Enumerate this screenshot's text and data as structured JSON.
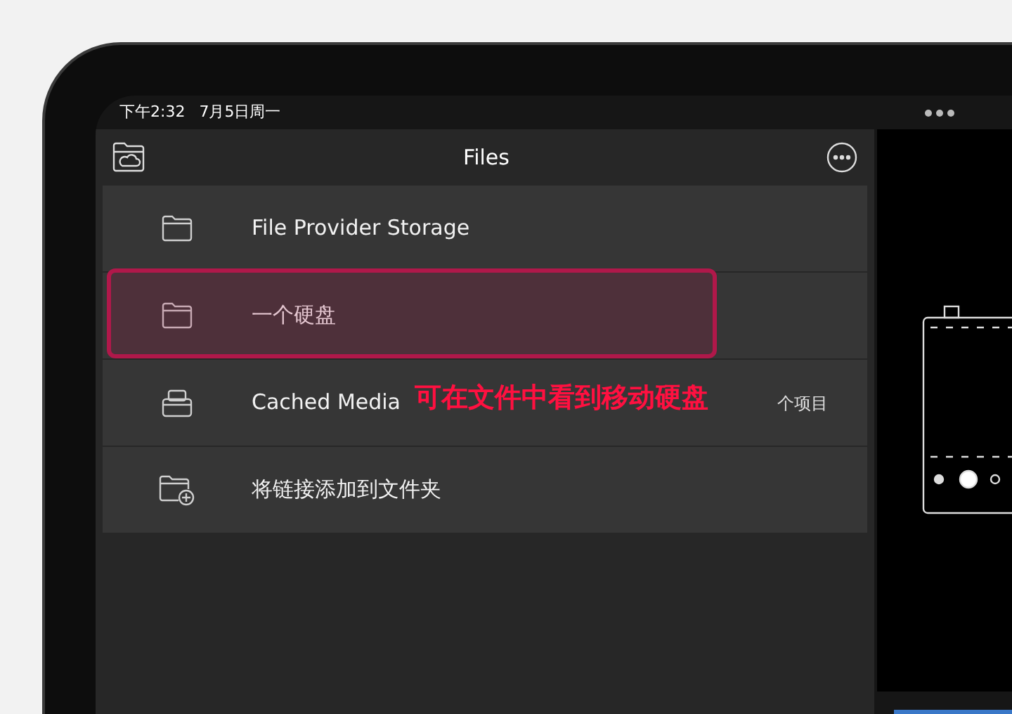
{
  "status_bar": {
    "time": "下午2:32",
    "date": "7月5日周一"
  },
  "nav": {
    "title": "Files"
  },
  "items": [
    {
      "kind": "folder",
      "label": "File Provider Storage",
      "highlighted": false
    },
    {
      "kind": "folder",
      "label": "一个硬盘",
      "highlighted": true
    },
    {
      "kind": "drive",
      "label": "Cached Media",
      "detail": "个项目",
      "highlighted": false
    },
    {
      "kind": "add-folder",
      "label": "将链接添加到文件夹",
      "highlighted": false
    }
  ],
  "caption": "可在文件中看到移动硬盘"
}
